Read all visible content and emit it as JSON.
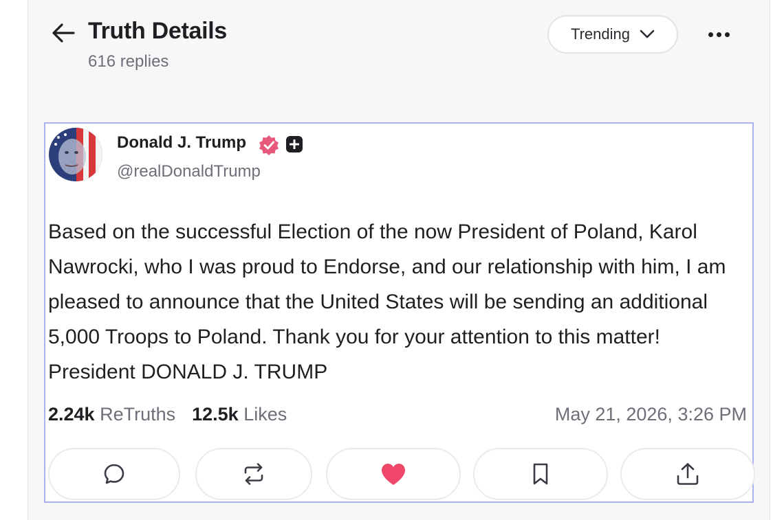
{
  "header": {
    "title": "Truth Details",
    "replies": "616 replies",
    "sort_label": "Trending"
  },
  "post": {
    "author_name": "Donald J. Trump",
    "handle": "@realDonaldTrump",
    "text": "Based on the successful Election of the now President of Poland, Karol Nawrocki, who I was proud to Endorse, and our relationship with him, I am pleased to announce that the United States will be sending an additional 5,000 Troops to Poland. Thank you for your attention to this matter! President DONALD J. TRUMP",
    "retruths_count": "2.24k",
    "retruths_label": "ReTruths",
    "likes_count": "12.5k",
    "likes_label": "Likes",
    "timestamp": "May 21, 2026, 3:26 PM"
  },
  "actions": [
    "reply-icon",
    "retruth-icon",
    "heart-icon",
    "bookmark-icon",
    "share-icon"
  ],
  "colors": {
    "verified_badge": "#e8587a",
    "like_active": "#f0476a",
    "post_border": "#aab3f0"
  }
}
